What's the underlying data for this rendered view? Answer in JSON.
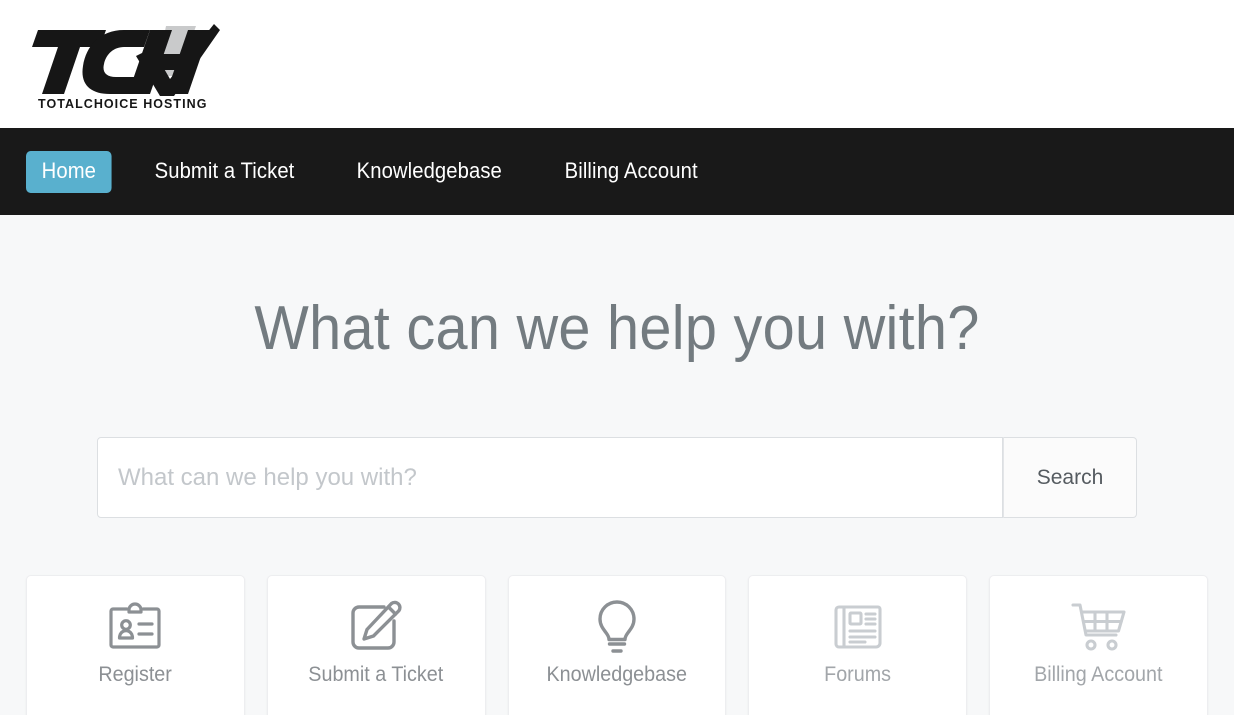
{
  "brand": {
    "logo_mark": "TCH",
    "logo_wordmark": "TOTALCHOICE HOSTING",
    "logo_icon_name": "tch-checkmark-logo"
  },
  "nav": {
    "background_color": "#191919",
    "active_color": "#59b0ce",
    "items": [
      {
        "label": "Home",
        "active": true
      },
      {
        "label": "Submit a Ticket",
        "active": false
      },
      {
        "label": "Knowledgebase",
        "active": false
      },
      {
        "label": "Billing Account",
        "active": false
      }
    ]
  },
  "hero": {
    "title": "What can we help you with?",
    "title_color": "#737b80"
  },
  "search": {
    "placeholder": "What can we help you with?",
    "value": "",
    "button_label": "Search"
  },
  "cards": [
    {
      "label": "Register",
      "icon": "id-badge-icon"
    },
    {
      "label": "Submit a Ticket",
      "icon": "pencil-square-icon"
    },
    {
      "label": "Knowledgebase",
      "icon": "lightbulb-icon"
    },
    {
      "label": "Forums",
      "icon": "newspaper-icon"
    },
    {
      "label": "Billing Account",
      "icon": "shopping-cart-icon"
    }
  ],
  "theme": {
    "page_background": "#f7f8f9",
    "card_background": "#ffffff",
    "icon_color": "#8c9094",
    "icon_color_muted": "#c9cdd1",
    "border_color": "#dcdfe2"
  }
}
